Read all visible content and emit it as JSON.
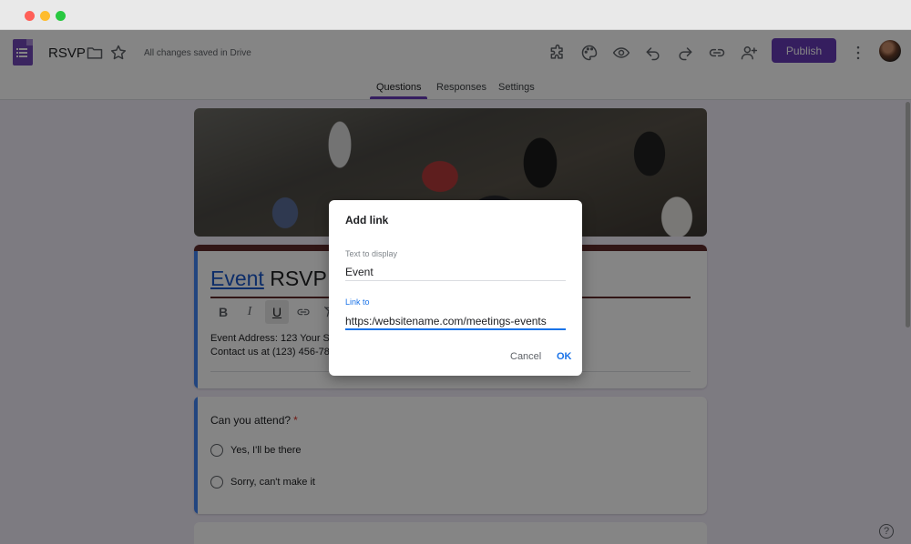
{
  "app": {
    "title": "RSVP",
    "save_status": "All changes saved in Drive",
    "publish_label": "Publish"
  },
  "tabs": [
    {
      "label": "Questions",
      "active": true
    },
    {
      "label": "Responses",
      "active": false
    },
    {
      "label": "Settings",
      "active": false
    }
  ],
  "form": {
    "title_link_text": "Event",
    "title_rest": "RSVP",
    "description_line1": "Event Address: 123 Your Street Your City, ST 12345",
    "description_line2": "Contact us at (123) 456-7890 or no_reply@example.com",
    "format_bold": "B",
    "format_italic": "I",
    "format_underline": "U"
  },
  "question": {
    "title": "Can you attend?",
    "required_mark": "*",
    "options": [
      "Yes,  I'll be there",
      "Sorry, can't make it"
    ]
  },
  "dialog": {
    "title": "Add link",
    "text_label": "Text to display",
    "text_value": "Event",
    "link_label": "Link to",
    "link_value": "https:/websitename.com/meetings-events",
    "cancel_label": "Cancel",
    "ok_label": "OK"
  },
  "help_glyph": "?",
  "colors": {
    "accent": "#673ab7",
    "link": "#1a73e8",
    "header_bar": "#5e2b2b",
    "required": "#d93025"
  },
  "icons": [
    "forms-logo-icon",
    "folder-icon",
    "star-icon",
    "addon-icon",
    "palette-icon",
    "preview-icon",
    "undo-icon",
    "redo-icon",
    "link-icon",
    "add-collaborator-icon",
    "more-vert-icon",
    "help-icon"
  ]
}
